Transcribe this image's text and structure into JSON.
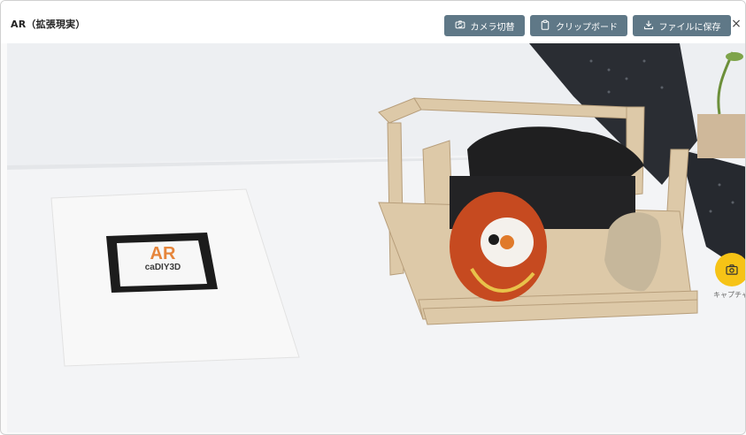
{
  "window": {
    "title": "AR（拡張現実）",
    "close_glyph": "×"
  },
  "toolbar": {
    "camera_switch": "カメラ切替",
    "clipboard": "クリップボード",
    "save_to_file": "ファイルに保存"
  },
  "marker": {
    "line1": "AR",
    "line2": "caDIY3D"
  },
  "capture": {
    "label": "キャプチャ"
  },
  "colors": {
    "toolbar_button": "#5f7887",
    "capture_button": "#f6c316",
    "marker_text": "#e6853b"
  },
  "icons": {
    "camera_switch": "camera-switch-icon",
    "clipboard": "clipboard-icon",
    "save": "download-icon",
    "capture": "camera-icon"
  }
}
